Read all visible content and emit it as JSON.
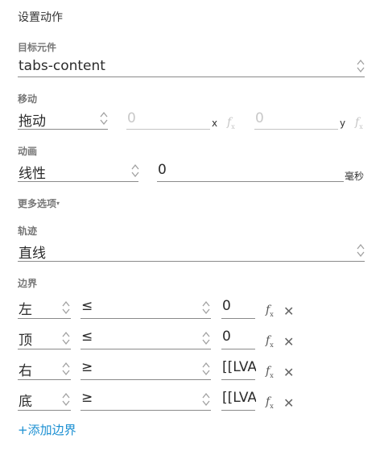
{
  "panel": {
    "title": "设置动作"
  },
  "target": {
    "label": "目标元件",
    "value": "tabs-content"
  },
  "move": {
    "label": "移动",
    "type_value": "拖动",
    "x_value": "0",
    "x_unit": "x",
    "y_value": "0",
    "y_unit": "y",
    "fx_icon": "function-icon"
  },
  "animation": {
    "label": "动画",
    "easing_value": "线性",
    "duration_value": "0",
    "duration_unit": "毫秒"
  },
  "more_options": {
    "label": "更多选项",
    "arrow": "▾"
  },
  "track": {
    "label": "轨迹",
    "value": "直线"
  },
  "bounds": {
    "label": "边界",
    "rows": [
      {
        "side": "左",
        "operator": "≤",
        "value": "0"
      },
      {
        "side": "顶",
        "operator": "≤",
        "value": "0"
      },
      {
        "side": "右",
        "operator": "≥",
        "value": "[[LVA"
      },
      {
        "side": "底",
        "operator": "≥",
        "value": "[[LVA"
      }
    ],
    "close_glyph": "✕",
    "add_label": "+添加边界"
  }
}
